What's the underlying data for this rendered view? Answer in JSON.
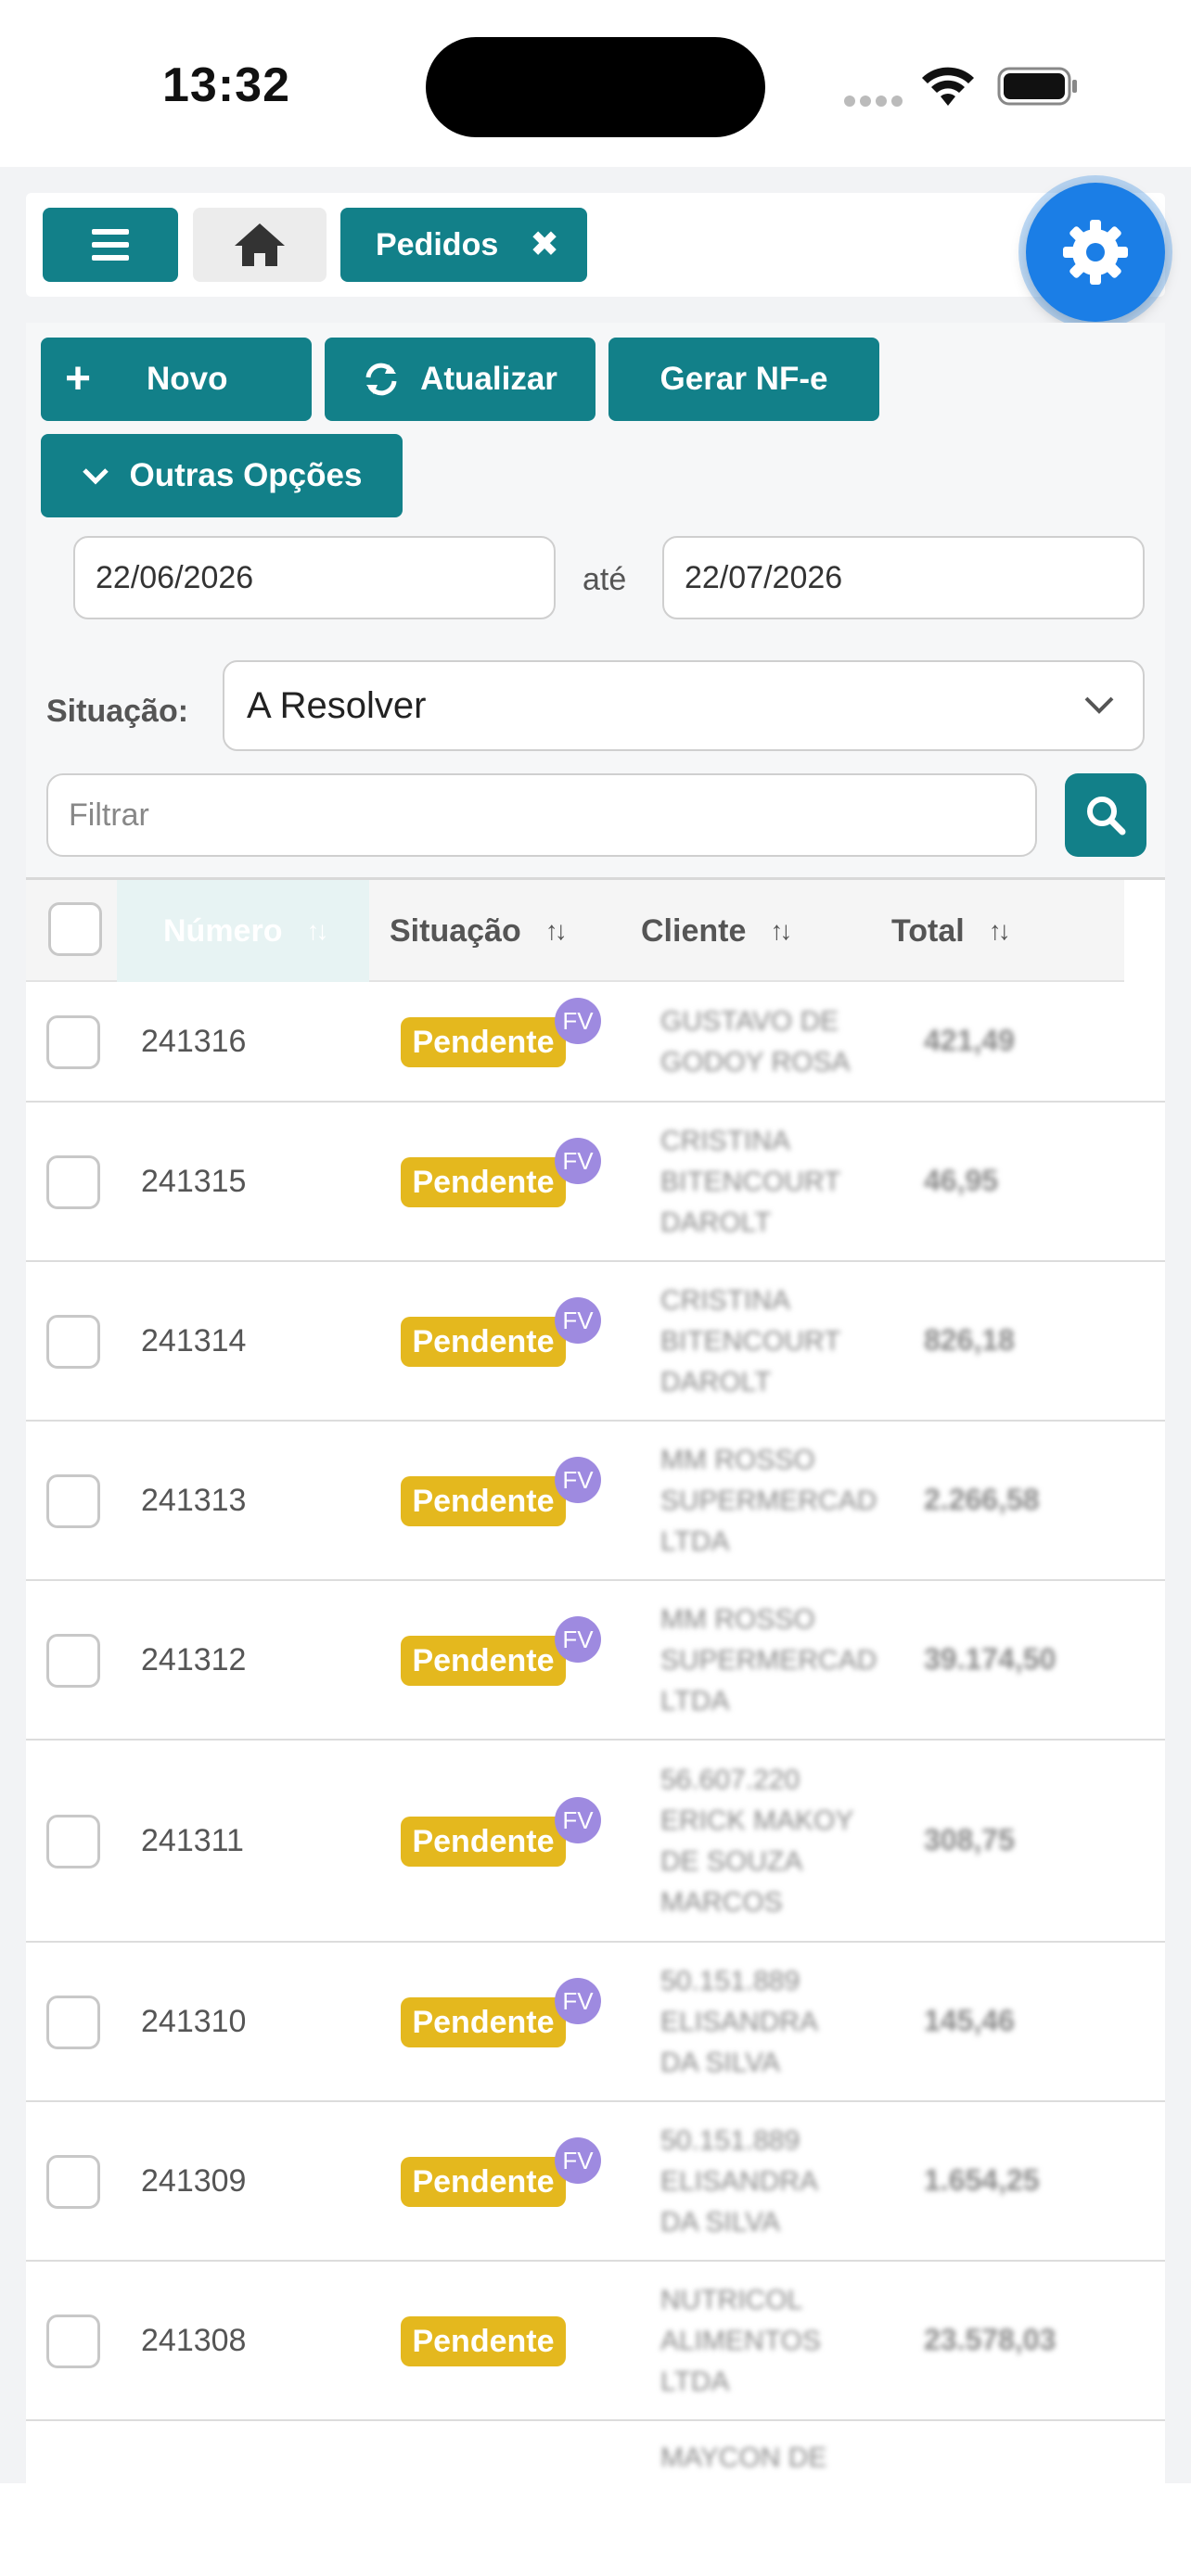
{
  "status_bar": {
    "time": "13:32"
  },
  "topbar": {
    "tab_label": "Pedidos",
    "tab_close": "✖"
  },
  "actions": {
    "novo": "Novo",
    "atualizar": "Atualizar",
    "gerar_nfe": "Gerar NF-e",
    "outras_opcoes": "Outras Opções"
  },
  "filters": {
    "date_from": "22/06/2026",
    "date_sep": "até",
    "date_to": "22/07/2026",
    "situacao_label": "Situação:",
    "situacao_value": "A Resolver",
    "filter_placeholder": "Filtrar"
  },
  "table": {
    "headers": {
      "numero": "Número",
      "situacao": "Situação",
      "cliente": "Cliente",
      "total": "Total"
    },
    "rows": [
      {
        "numero": "241316",
        "situacao": "Pendente",
        "fv": "FV",
        "cliente": [
          "GUSTAVO DE",
          "GODOY ROSA"
        ],
        "total": "421,49"
      },
      {
        "numero": "241315",
        "situacao": "Pendente",
        "fv": "FV",
        "cliente": [
          "CRISTINA",
          "BITENCOURT",
          "DAROLT"
        ],
        "total": "46,95"
      },
      {
        "numero": "241314",
        "situacao": "Pendente",
        "fv": "FV",
        "cliente": [
          "CRISTINA",
          "BITENCOURT",
          "DAROLT"
        ],
        "total": "826,18"
      },
      {
        "numero": "241313",
        "situacao": "Pendente",
        "fv": "FV",
        "cliente": [
          "MM ROSSO",
          "SUPERMERCAD",
          "LTDA"
        ],
        "total": "2.266,58"
      },
      {
        "numero": "241312",
        "situacao": "Pendente",
        "fv": "FV",
        "cliente": [
          "MM ROSSO",
          "SUPERMERCAD",
          "LTDA"
        ],
        "total": "39.174,50"
      },
      {
        "numero": "241311",
        "situacao": "Pendente",
        "fv": "FV",
        "cliente": [
          "56.607.220",
          "ERICK MAKOY",
          "DE SOUZA",
          "MARCOS"
        ],
        "total": "308,75"
      },
      {
        "numero": "241310",
        "situacao": "Pendente",
        "fv": "FV",
        "cliente": [
          "50.151.889",
          "ELISANDRA",
          "DA SILVA"
        ],
        "total": "145,46"
      },
      {
        "numero": "241309",
        "situacao": "Pendente",
        "fv": "FV",
        "cliente": [
          "50.151.889",
          "ELISANDRA",
          "DA SILVA"
        ],
        "total": "1.654,25"
      },
      {
        "numero": "241308",
        "situacao": "Pendente",
        "fv": "",
        "cliente": [
          "NUTRICOL",
          "ALIMENTOS",
          "LTDA"
        ],
        "total": "23.578,03"
      },
      {
        "numero": "",
        "situacao": "",
        "fv": "",
        "cliente": [
          "MAYCON DE"
        ],
        "total": ""
      }
    ]
  },
  "colors": {
    "accent": "#128089",
    "badge": "#e4b81e",
    "fv": "#9e8ae0",
    "fab": "#1b7ee6"
  }
}
